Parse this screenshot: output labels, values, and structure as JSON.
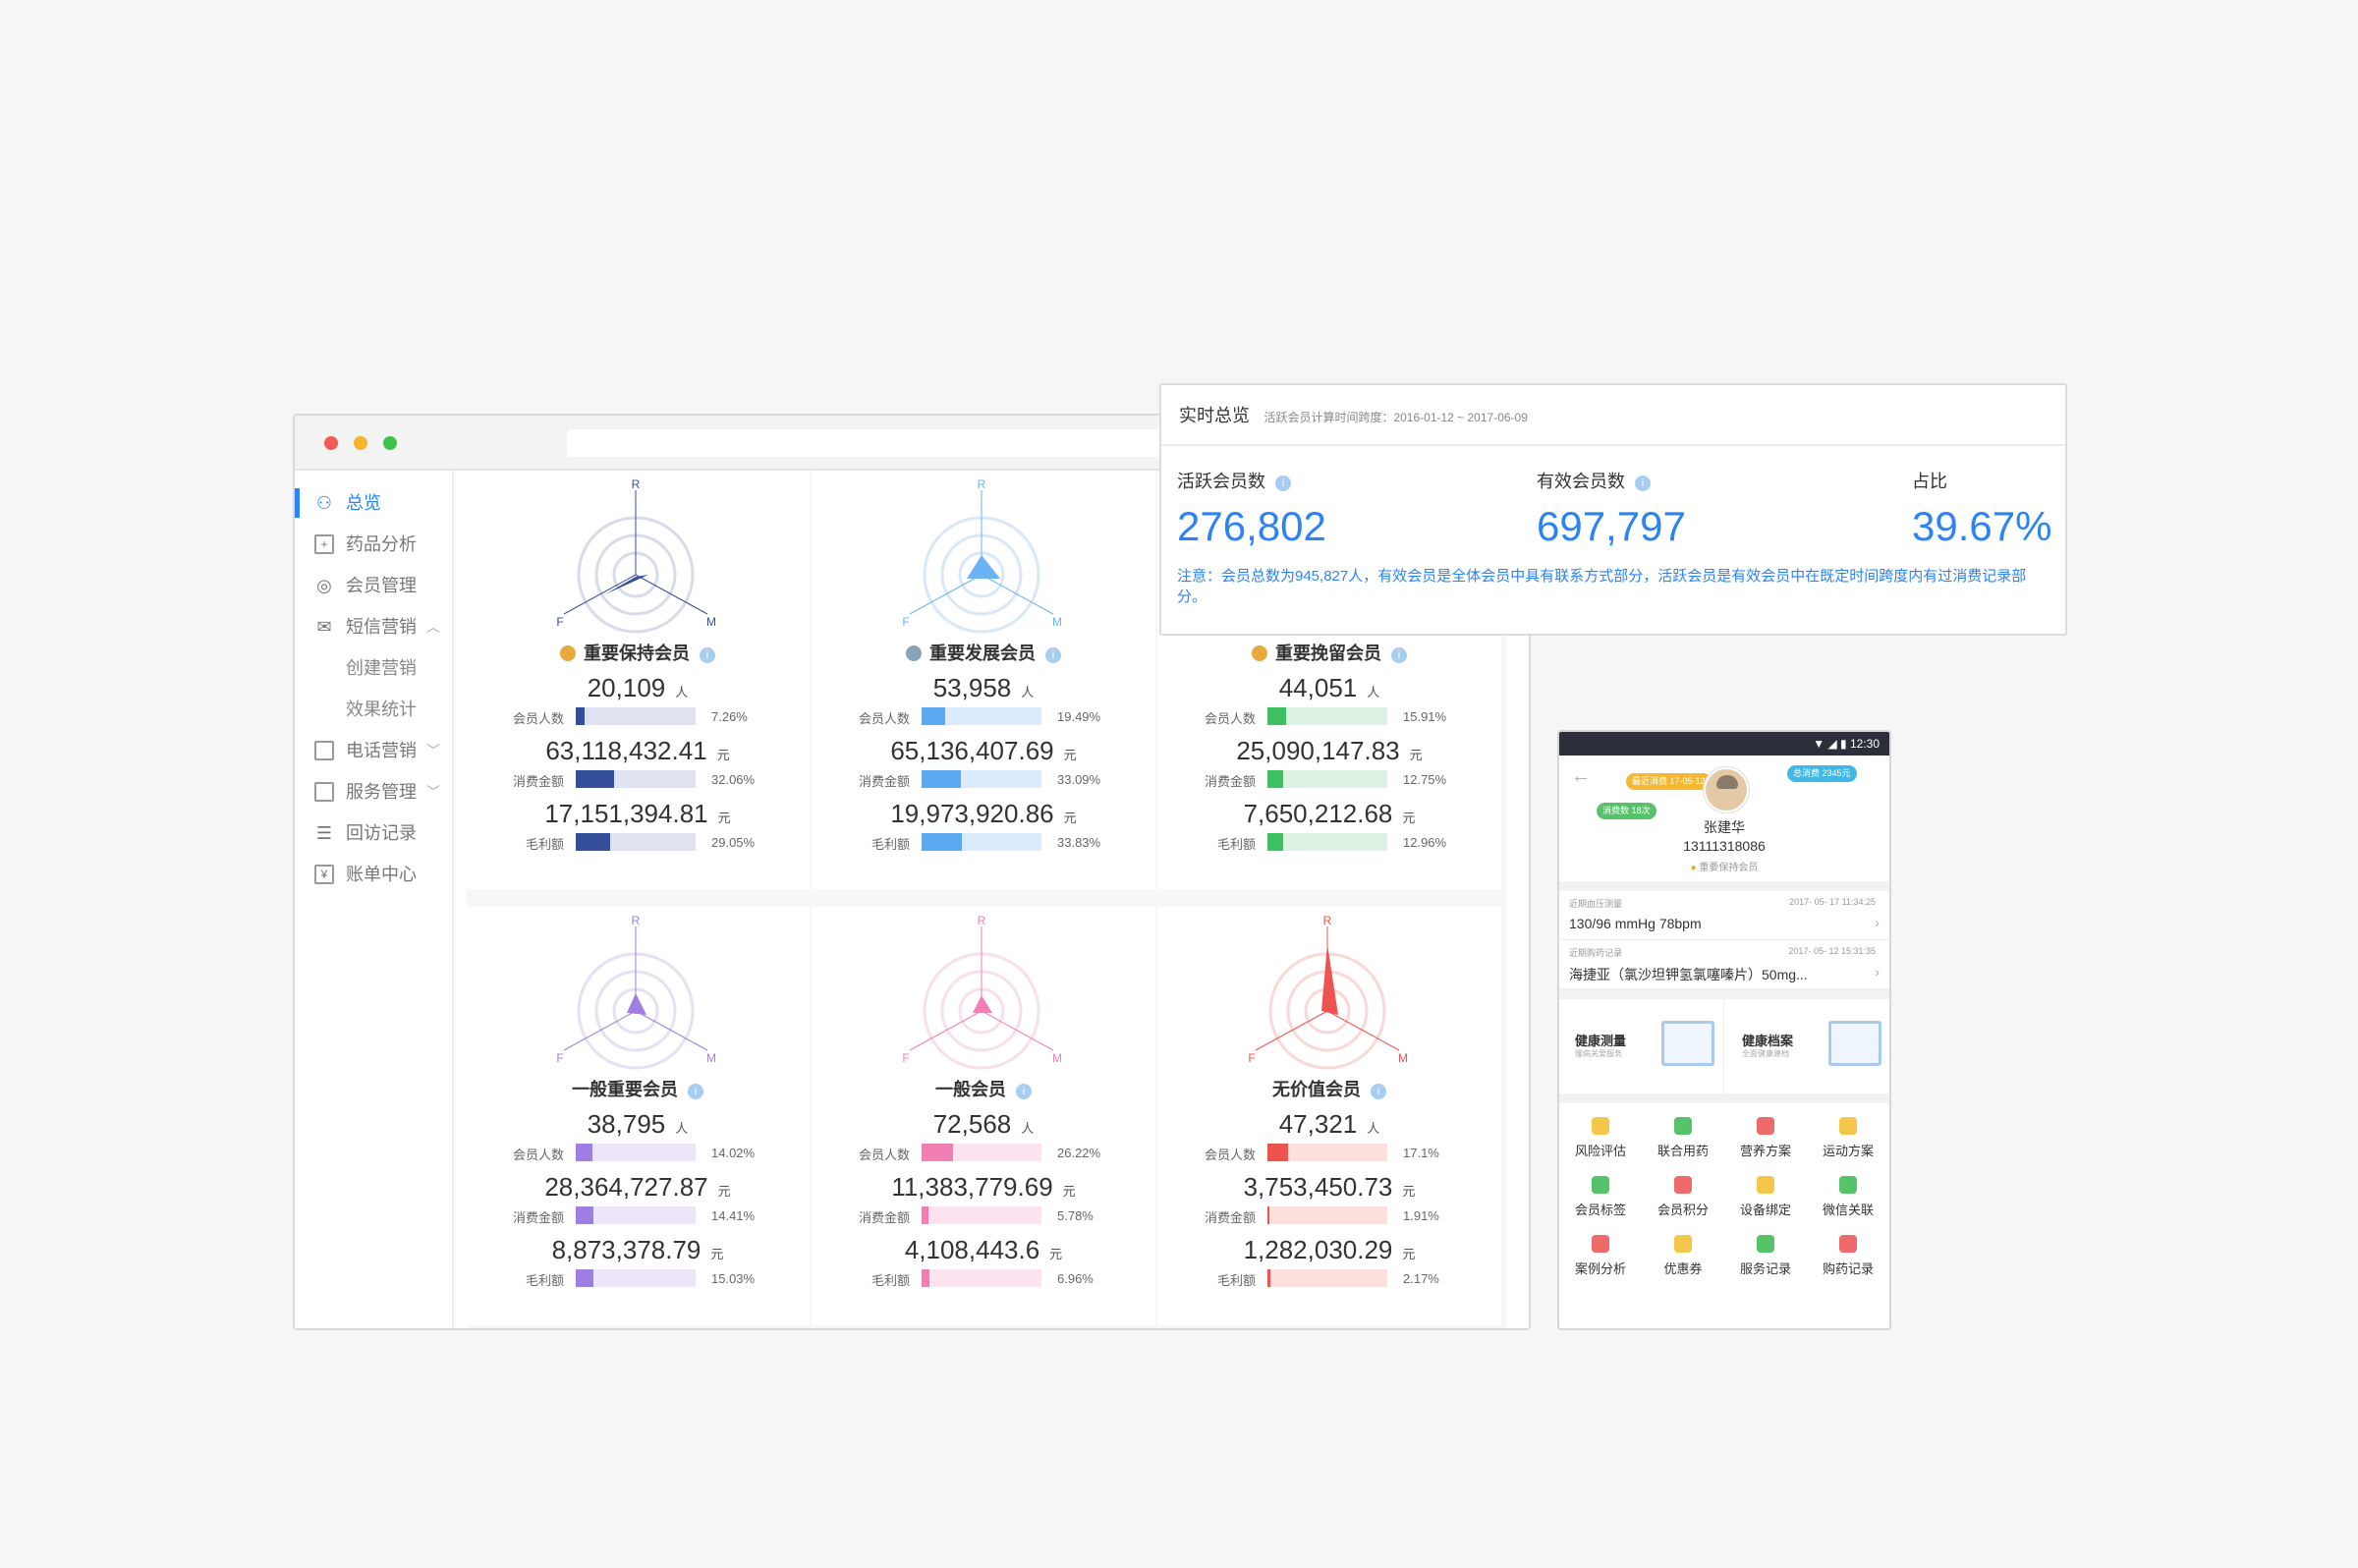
{
  "sidebar": {
    "items": [
      {
        "label": "总览",
        "icon": "overview-icon",
        "active": true
      },
      {
        "label": "药品分析",
        "icon": "medicine-icon"
      },
      {
        "label": "会员管理",
        "icon": "member-icon"
      },
      {
        "label": "短信营销",
        "icon": "mail-icon",
        "expanded": true
      },
      {
        "label": "电话营销",
        "icon": "phone-icon"
      },
      {
        "label": "服务管理",
        "icon": "service-icon"
      },
      {
        "label": "回访记录",
        "icon": "record-icon"
      },
      {
        "label": "账单中心",
        "icon": "bill-icon"
      }
    ],
    "sub_items": [
      "创建营销",
      "效果统计"
    ]
  },
  "cards": [
    {
      "title": "重要保持会员",
      "color": "#35509a",
      "track": "#dfe3ef",
      "medal": "#e8a93c",
      "radar": "dark",
      "axis": [
        "R",
        "F",
        "M"
      ],
      "members": {
        "value": "20,109",
        "unit": "人",
        "label": "会员人数",
        "pct": "7.26%",
        "frac": 0.0726
      },
      "amount": {
        "value": "63,118,432.41",
        "unit": "元",
        "label": "消费金额",
        "pct": "32.06%",
        "frac": 0.3206
      },
      "profit": {
        "value": "17,151,394.81",
        "unit": "元",
        "label": "毛利额",
        "pct": "29.05%",
        "frac": 0.2905
      }
    },
    {
      "title": "重要发展会员",
      "color": "#5ba9f0",
      "track": "#dcebfb",
      "medal": "#8aa3b6",
      "radar": "blue",
      "axis": [
        "R",
        "F",
        "M"
      ],
      "members": {
        "value": "53,958",
        "unit": "人",
        "label": "会员人数",
        "pct": "19.49%",
        "frac": 0.1949
      },
      "amount": {
        "value": "65,136,407.69",
        "unit": "元",
        "label": "消费金额",
        "pct": "33.09%",
        "frac": 0.3309
      },
      "profit": {
        "value": "19,973,920.86",
        "unit": "元",
        "label": "毛利额",
        "pct": "33.83%",
        "frac": 0.3383
      }
    },
    {
      "title": "重要挽留会员",
      "color": "#3dbf62",
      "track": "#dcf3e3",
      "medal": "#e8a93c",
      "radar": "none",
      "axis": [],
      "members": {
        "value": "44,051",
        "unit": "人",
        "label": "会员人数",
        "pct": "15.91%",
        "frac": 0.1591
      },
      "amount": {
        "value": "25,090,147.83",
        "unit": "元",
        "label": "消费金额",
        "pct": "12.75%",
        "frac": 0.1275
      },
      "profit": {
        "value": "7,650,212.68",
        "unit": "元",
        "label": "毛利额",
        "pct": "12.96%",
        "frac": 0.1296
      }
    },
    {
      "title": "一般重要会员",
      "color": "#a07ee2",
      "track": "#ece6f8",
      "medal": "",
      "radar": "purple",
      "axis": [
        "R",
        "F",
        "M"
      ],
      "members": {
        "value": "38,795",
        "unit": "人",
        "label": "会员人数",
        "pct": "14.02%",
        "frac": 0.1402
      },
      "amount": {
        "value": "28,364,727.87",
        "unit": "元",
        "label": "消费金额",
        "pct": "14.41%",
        "frac": 0.1441
      },
      "profit": {
        "value": "8,873,378.79",
        "unit": "元",
        "label": "毛利额",
        "pct": "15.03%",
        "frac": 0.1503
      }
    },
    {
      "title": "一般会员",
      "color": "#f17fb4",
      "track": "#fde3ef",
      "medal": "",
      "radar": "pink",
      "axis": [
        "R",
        "F",
        "M"
      ],
      "members": {
        "value": "72,568",
        "unit": "人",
        "label": "会员人数",
        "pct": "26.22%",
        "frac": 0.2622
      },
      "amount": {
        "value": "11,383,779.69",
        "unit": "元",
        "label": "消费金额",
        "pct": "5.78%",
        "frac": 0.0578
      },
      "profit": {
        "value": "4,108,443.6",
        "unit": "元",
        "label": "毛利额",
        "pct": "6.96%",
        "frac": 0.0696
      }
    },
    {
      "title": "无价值会员",
      "color": "#ef5350",
      "track": "#fde1df",
      "medal": "",
      "radar": "red",
      "axis": [
        "R",
        "F",
        "M"
      ],
      "members": {
        "value": "47,321",
        "unit": "人",
        "label": "会员人数",
        "pct": "17.1%",
        "frac": 0.171
      },
      "amount": {
        "value": "3,753,450.73",
        "unit": "元",
        "label": "消费金额",
        "pct": "1.91%",
        "frac": 0.0191
      },
      "profit": {
        "value": "1,282,030.29",
        "unit": "元",
        "label": "毛利额",
        "pct": "2.17%",
        "frac": 0.0217
      }
    }
  ],
  "realtime": {
    "title": "实时总览",
    "subtitle": "活跃会员计算时间跨度：2016-01-12 ~ 2017-06-09",
    "active_label": "活跃会员数",
    "active_value": "276,802",
    "valid_label": "有效会员数",
    "valid_value": "697,797",
    "ratio_label": "占比",
    "ratio_value": "39.67%",
    "note": "注意：会员总数为945,827人，有效会员是全体会员中具有联系方式部分，活跃会员是有效会员中在既定时间跨度内有过消费记录部分。"
  },
  "phone": {
    "status_time": "12:30",
    "name": "张建华",
    "phone": "13111318086",
    "level": "重要保持会员",
    "bubbles": [
      "最近消费 17-05-12",
      "总消费 2345元",
      "消费数 18次"
    ],
    "bp_caption": "近期血压测量",
    "bp_date": "2017- 05- 17 11:34:25",
    "bp_value": "130/96 mmHg   78bpm",
    "med_caption": "近期购药记录",
    "med_date": "2017- 05- 12 15:31:35",
    "med_value": "海捷亚（氯沙坦钾氢氯噻嗪片）50mg...",
    "card1_title": "健康测量",
    "card1_sub": "慢病关爱服务",
    "card2_title": "健康档案",
    "card2_sub": "全面健康建档",
    "icons": [
      {
        "label": "风险评估",
        "color": "#f4c64a"
      },
      {
        "label": "联合用药",
        "color": "#56c36b"
      },
      {
        "label": "营养方案",
        "color": "#ef6a6a"
      },
      {
        "label": "运动方案",
        "color": "#f4c64a"
      },
      {
        "label": "会员标签",
        "color": "#56c36b"
      },
      {
        "label": "会员积分",
        "color": "#ef6a6a"
      },
      {
        "label": "设备绑定",
        "color": "#f4c64a"
      },
      {
        "label": "微信关联",
        "color": "#56c36b"
      },
      {
        "label": "案例分析",
        "color": "#ef6a6a"
      },
      {
        "label": "优惠券",
        "color": "#f4c64a"
      },
      {
        "label": "服务记录",
        "color": "#56c36b"
      },
      {
        "label": "购药记录",
        "color": "#ef6a6a"
      }
    ]
  }
}
